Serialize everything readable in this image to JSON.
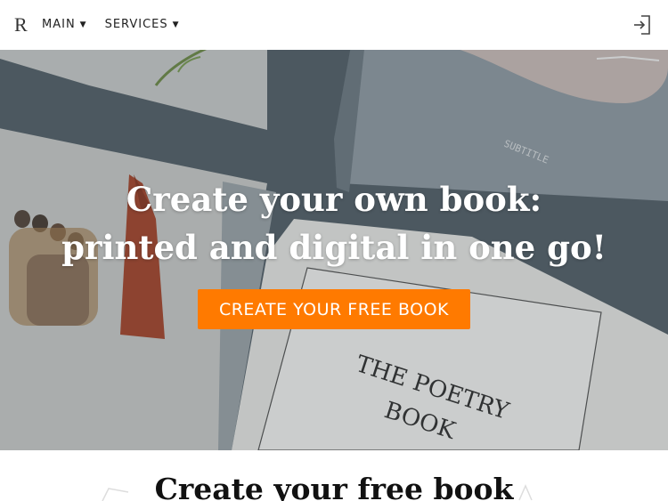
{
  "header": {
    "brand": "R",
    "nav": [
      {
        "label": "MAIN"
      },
      {
        "label": "SERVICES"
      }
    ]
  },
  "hero": {
    "title_line1": "Create your own book:",
    "title_line2": "printed and digital in one go!",
    "cta_label": "CREATE YOUR FREE BOOK",
    "book_spine_text": "SUBTITLE",
    "ereader_text_line1": "THE POETRY",
    "ereader_text_line2": "BOOK"
  },
  "section": {
    "title": "Create your free book"
  },
  "colors": {
    "accent": "#ff7a00",
    "hero_bg": "#4b5760",
    "header_bg": "#ffffff"
  }
}
